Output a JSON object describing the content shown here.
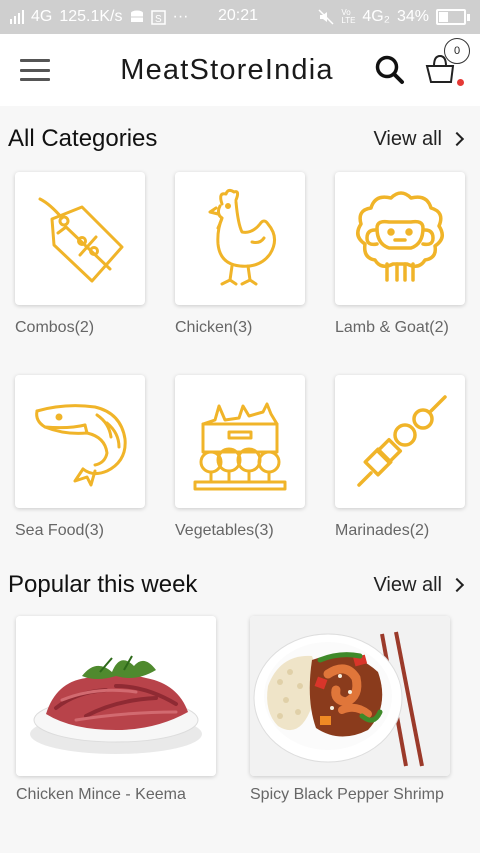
{
  "status_bar": {
    "network": "4G",
    "speed": "125.1K/s",
    "dots": "···",
    "time": "20:21",
    "volte": "Vo LTE",
    "network2": "4G₂",
    "battery": "34%"
  },
  "header": {
    "brand": "MeatStoreIndia",
    "cart_count": "0"
  },
  "categories": {
    "title": "All Categories",
    "view_all": "View all",
    "items": [
      {
        "label": "Combos(2)",
        "icon": "price-tag-icon"
      },
      {
        "label": "Chicken(3)",
        "icon": "chicken-icon"
      },
      {
        "label": "Lamb & Goat(2)",
        "icon": "sheep-icon"
      },
      {
        "label": "Sea Food(3)",
        "icon": "shrimp-icon"
      },
      {
        "label": "Vegetables(3)",
        "icon": "vegetables-crate-icon"
      },
      {
        "label": "Marinades(2)",
        "icon": "skewer-icon"
      }
    ]
  },
  "popular": {
    "title": "Popular this week",
    "view_all": "View all",
    "items": [
      {
        "label": "Chicken Mince - Keema"
      },
      {
        "label": "Spicy Black Pepper Shrimp"
      }
    ]
  },
  "colors": {
    "accent": "#F0B429",
    "status_bar": "#CFCFCF",
    "background": "#F7F7F7"
  }
}
